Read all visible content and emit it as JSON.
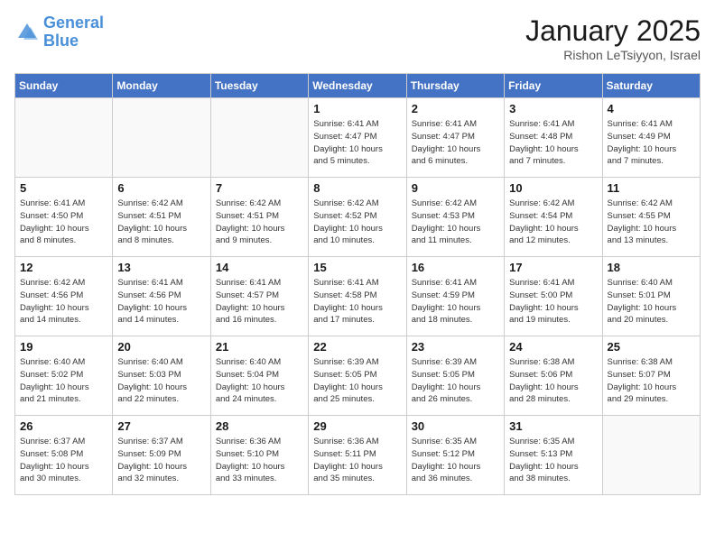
{
  "header": {
    "logo_line1": "General",
    "logo_line2": "Blue",
    "month_title": "January 2025",
    "subtitle": "Rishon LeTsiyyon, Israel"
  },
  "days_of_week": [
    "Sunday",
    "Monday",
    "Tuesday",
    "Wednesday",
    "Thursday",
    "Friday",
    "Saturday"
  ],
  "weeks": [
    [
      {
        "num": "",
        "info": ""
      },
      {
        "num": "",
        "info": ""
      },
      {
        "num": "",
        "info": ""
      },
      {
        "num": "1",
        "info": "Sunrise: 6:41 AM\nSunset: 4:47 PM\nDaylight: 10 hours\nand 5 minutes."
      },
      {
        "num": "2",
        "info": "Sunrise: 6:41 AM\nSunset: 4:47 PM\nDaylight: 10 hours\nand 6 minutes."
      },
      {
        "num": "3",
        "info": "Sunrise: 6:41 AM\nSunset: 4:48 PM\nDaylight: 10 hours\nand 7 minutes."
      },
      {
        "num": "4",
        "info": "Sunrise: 6:41 AM\nSunset: 4:49 PM\nDaylight: 10 hours\nand 7 minutes."
      }
    ],
    [
      {
        "num": "5",
        "info": "Sunrise: 6:41 AM\nSunset: 4:50 PM\nDaylight: 10 hours\nand 8 minutes."
      },
      {
        "num": "6",
        "info": "Sunrise: 6:42 AM\nSunset: 4:51 PM\nDaylight: 10 hours\nand 8 minutes."
      },
      {
        "num": "7",
        "info": "Sunrise: 6:42 AM\nSunset: 4:51 PM\nDaylight: 10 hours\nand 9 minutes."
      },
      {
        "num": "8",
        "info": "Sunrise: 6:42 AM\nSunset: 4:52 PM\nDaylight: 10 hours\nand 10 minutes."
      },
      {
        "num": "9",
        "info": "Sunrise: 6:42 AM\nSunset: 4:53 PM\nDaylight: 10 hours\nand 11 minutes."
      },
      {
        "num": "10",
        "info": "Sunrise: 6:42 AM\nSunset: 4:54 PM\nDaylight: 10 hours\nand 12 minutes."
      },
      {
        "num": "11",
        "info": "Sunrise: 6:42 AM\nSunset: 4:55 PM\nDaylight: 10 hours\nand 13 minutes."
      }
    ],
    [
      {
        "num": "12",
        "info": "Sunrise: 6:42 AM\nSunset: 4:56 PM\nDaylight: 10 hours\nand 14 minutes."
      },
      {
        "num": "13",
        "info": "Sunrise: 6:41 AM\nSunset: 4:56 PM\nDaylight: 10 hours\nand 14 minutes."
      },
      {
        "num": "14",
        "info": "Sunrise: 6:41 AM\nSunset: 4:57 PM\nDaylight: 10 hours\nand 16 minutes."
      },
      {
        "num": "15",
        "info": "Sunrise: 6:41 AM\nSunset: 4:58 PM\nDaylight: 10 hours\nand 17 minutes."
      },
      {
        "num": "16",
        "info": "Sunrise: 6:41 AM\nSunset: 4:59 PM\nDaylight: 10 hours\nand 18 minutes."
      },
      {
        "num": "17",
        "info": "Sunrise: 6:41 AM\nSunset: 5:00 PM\nDaylight: 10 hours\nand 19 minutes."
      },
      {
        "num": "18",
        "info": "Sunrise: 6:40 AM\nSunset: 5:01 PM\nDaylight: 10 hours\nand 20 minutes."
      }
    ],
    [
      {
        "num": "19",
        "info": "Sunrise: 6:40 AM\nSunset: 5:02 PM\nDaylight: 10 hours\nand 21 minutes."
      },
      {
        "num": "20",
        "info": "Sunrise: 6:40 AM\nSunset: 5:03 PM\nDaylight: 10 hours\nand 22 minutes."
      },
      {
        "num": "21",
        "info": "Sunrise: 6:40 AM\nSunset: 5:04 PM\nDaylight: 10 hours\nand 24 minutes."
      },
      {
        "num": "22",
        "info": "Sunrise: 6:39 AM\nSunset: 5:05 PM\nDaylight: 10 hours\nand 25 minutes."
      },
      {
        "num": "23",
        "info": "Sunrise: 6:39 AM\nSunset: 5:05 PM\nDaylight: 10 hours\nand 26 minutes."
      },
      {
        "num": "24",
        "info": "Sunrise: 6:38 AM\nSunset: 5:06 PM\nDaylight: 10 hours\nand 28 minutes."
      },
      {
        "num": "25",
        "info": "Sunrise: 6:38 AM\nSunset: 5:07 PM\nDaylight: 10 hours\nand 29 minutes."
      }
    ],
    [
      {
        "num": "26",
        "info": "Sunrise: 6:37 AM\nSunset: 5:08 PM\nDaylight: 10 hours\nand 30 minutes."
      },
      {
        "num": "27",
        "info": "Sunrise: 6:37 AM\nSunset: 5:09 PM\nDaylight: 10 hours\nand 32 minutes."
      },
      {
        "num": "28",
        "info": "Sunrise: 6:36 AM\nSunset: 5:10 PM\nDaylight: 10 hours\nand 33 minutes."
      },
      {
        "num": "29",
        "info": "Sunrise: 6:36 AM\nSunset: 5:11 PM\nDaylight: 10 hours\nand 35 minutes."
      },
      {
        "num": "30",
        "info": "Sunrise: 6:35 AM\nSunset: 5:12 PM\nDaylight: 10 hours\nand 36 minutes."
      },
      {
        "num": "31",
        "info": "Sunrise: 6:35 AM\nSunset: 5:13 PM\nDaylight: 10 hours\nand 38 minutes."
      },
      {
        "num": "",
        "info": ""
      }
    ]
  ]
}
